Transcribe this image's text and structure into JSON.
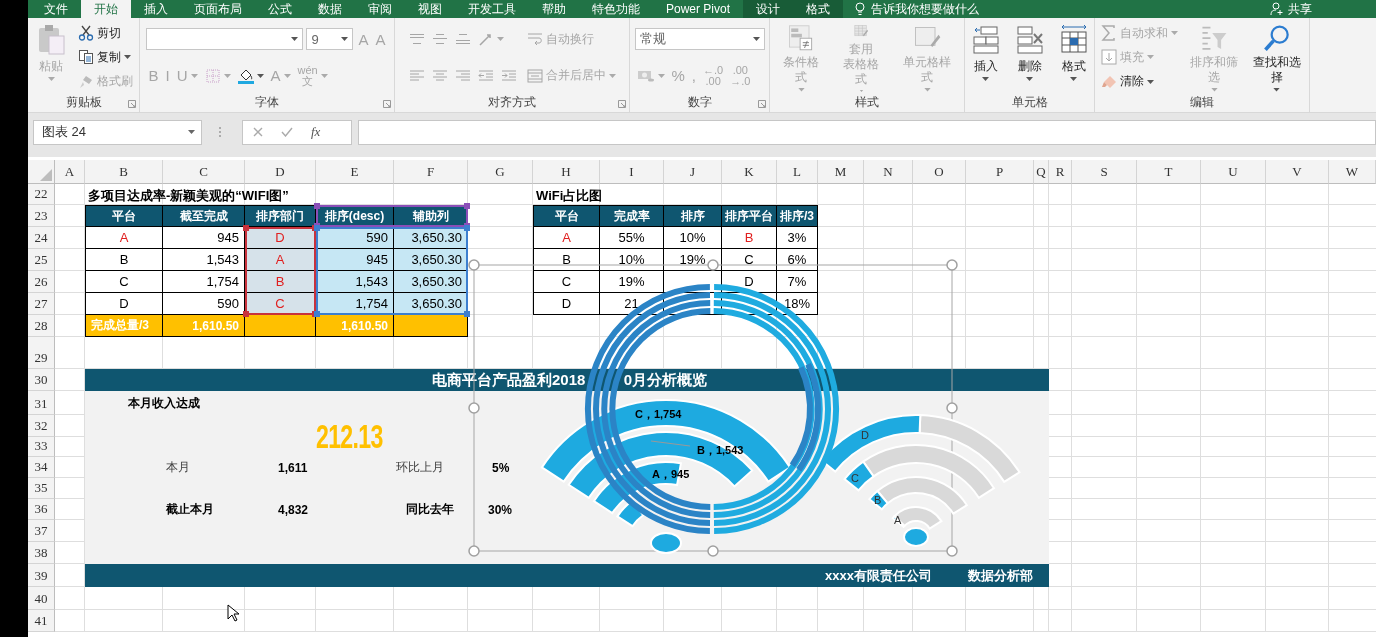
{
  "tabs": [
    {
      "label": "文件",
      "selected": false
    },
    {
      "label": "开始",
      "selected": true
    },
    {
      "label": "插入",
      "selected": false
    },
    {
      "label": "页面布局",
      "selected": false
    },
    {
      "label": "公式",
      "selected": false
    },
    {
      "label": "数据",
      "selected": false
    },
    {
      "label": "审阅",
      "selected": false
    },
    {
      "label": "视图",
      "selected": false
    },
    {
      "label": "开发工具",
      "selected": false
    },
    {
      "label": "帮助",
      "selected": false
    },
    {
      "label": "特色功能",
      "selected": false
    },
    {
      "label": "Power Pivot",
      "selected": false
    },
    {
      "label": "设计",
      "selected": false,
      "kind": "context"
    },
    {
      "label": "格式",
      "selected": false,
      "kind": "context"
    }
  ],
  "tell_me": {
    "placeholder": "告诉我你想要做什么"
  },
  "share": "共享",
  "ribbon": [
    {
      "label": "剪贴板",
      "launcher": true,
      "columns": [
        [
          {
            "kind": "large",
            "label": "粘贴",
            "disabled": true,
            "dropdown": true
          }
        ],
        [
          {
            "kind": "small",
            "label": "剪切",
            "disabled": false
          },
          {
            "kind": "small",
            "label": "复制",
            "disabled": false,
            "dropdown": true
          },
          {
            "kind": "small",
            "label": "格式刷",
            "disabled": true
          }
        ]
      ]
    },
    {
      "label": "字体",
      "launcher": true,
      "columns": [
        [
          {
            "kind": "row",
            "items": [
              {
                "kind": "field",
                "dropdown": true
              },
              {
                "kind": "field",
                "value": "9",
                "dropdown": true
              },
              {
                "kind": "glyph",
                "label": "A",
                "disabled": true
              },
              {
                "kind": "glyph",
                "label": "A",
                "disabled": true
              }
            ]
          },
          {
            "kind": "row",
            "items": [
              {
                "kind": "glyph",
                "label": "B",
                "disabled": true
              },
              {
                "kind": "glyph",
                "label": "I",
                "disabled": true
              },
              {
                "kind": "glyph",
                "label": "U",
                "disabled": true,
                "dropdown": true
              },
              {
                "kind": "icon",
                "disabled": true,
                "dropdown": true
              },
              {
                "kind": "icon",
                "disabled": false,
                "dropdown": true
              },
              {
                "kind": "glyph",
                "label": "A",
                "disabled": true,
                "dropdown": true
              },
              {
                "kind": "glyph",
                "label": "wén",
                "sub": "文",
                "disabled": true,
                "dropdown": true
              }
            ]
          }
        ]
      ]
    },
    {
      "label": "对齐方式",
      "launcher": true,
      "columns": [
        [
          {
            "kind": "row",
            "items": [
              {
                "kind": "icon",
                "disabled": true
              },
              {
                "kind": "icon",
                "disabled": true
              },
              {
                "kind": "icon",
                "disabled": true
              },
              {
                "kind": "icon",
                "disabled": true,
                "dropdown": true
              }
            ]
          },
          {
            "kind": "row",
            "items": [
              {
                "kind": "icon",
                "disabled": true
              },
              {
                "kind": "icon",
                "disabled": true
              },
              {
                "kind": "icon",
                "disabled": true
              },
              {
                "kind": "icon",
                "disabled": true
              },
              {
                "kind": "icon",
                "disabled": true
              }
            ]
          }
        ],
        [
          {
            "kind": "small",
            "label": "自动换行",
            "disabled": true
          },
          {
            "kind": "small",
            "label": "合并后居中",
            "disabled": true,
            "dropdown": true
          }
        ]
      ]
    },
    {
      "label": "数字",
      "launcher": true,
      "columns": [
        [
          {
            "kind": "row",
            "items": [
              {
                "kind": "field",
                "value": "常规",
                "dropdown": true
              }
            ]
          },
          {
            "kind": "row",
            "items": [
              {
                "kind": "icon",
                "disabled": true,
                "dropdown": true
              },
              {
                "kind": "glyph",
                "label": "%",
                "disabled": true
              },
              {
                "kind": "glyph",
                "label": ",",
                "disabled": true
              },
              {
                "kind": "glyph",
                "label": "←.0",
                "sub": ".00",
                "disabled": true
              },
              {
                "kind": "glyph",
                "label": ".00",
                "sub": "→.0",
                "disabled": true
              }
            ]
          }
        ]
      ]
    },
    {
      "label": "样式",
      "columns": [
        [
          {
            "kind": "large",
            "label": "条件格式",
            "disabled": true,
            "dropdown": true
          }
        ],
        [
          {
            "kind": "large",
            "label": "套用",
            "label_line2": "表格格式",
            "disabled": true,
            "dropdown": true
          }
        ],
        [
          {
            "kind": "large",
            "label": "单元格样式",
            "disabled": true,
            "dropdown": true
          }
        ]
      ]
    },
    {
      "label": "单元格",
      "columns": [
        [
          {
            "kind": "large",
            "label": "插入",
            "disabled": false,
            "dropdown": true
          }
        ],
        [
          {
            "kind": "large",
            "label": "删除",
            "disabled": false,
            "dropdown": true
          }
        ],
        [
          {
            "kind": "large",
            "label": "格式",
            "disabled": false,
            "dropdown": true
          }
        ]
      ]
    },
    {
      "label": "编辑",
      "columns": [
        [
          {
            "kind": "small",
            "label": "自动求和",
            "disabled": true,
            "dropdown": true
          },
          {
            "kind": "small",
            "label": "填充",
            "disabled": true,
            "dropdown": true
          },
          {
            "kind": "small",
            "label": "清除",
            "disabled": false,
            "dropdown": true
          }
        ],
        [
          {
            "kind": "large",
            "label": "排序和筛选",
            "disabled": true,
            "dropdown": true
          }
        ],
        [
          {
            "kind": "large",
            "label": "查找和选择",
            "disabled": false,
            "dropdown": true
          }
        ]
      ]
    }
  ],
  "name_box": "图表 24",
  "function_label": "fx",
  "columns": [
    "A",
    "B",
    "C",
    "D",
    "E",
    "F",
    "G",
    "H",
    "I",
    "J",
    "K",
    "L",
    "M",
    "N",
    "O",
    "P",
    "Q",
    "R",
    "S",
    "T",
    "U",
    "V",
    "W"
  ],
  "rows": [
    "22",
    "23",
    "24",
    "25",
    "26",
    "27",
    "28",
    "29",
    "30",
    "31",
    "32",
    "33",
    "34",
    "35",
    "36",
    "37",
    "38",
    "39",
    "40",
    "41"
  ],
  "table1": {
    "title": "多项目达成率-新颖美观的“WIFI图”",
    "columns": [
      {
        "label": "平台"
      },
      {
        "label": "截至完成"
      },
      {
        "label": "排序部门",
        "label_range": true
      },
      {
        "label": "排序(desc)",
        "value_range": true
      },
      {
        "label": "辅助列",
        "value_range": true
      }
    ],
    "rows": [
      [
        {
          "text": "A",
          "alert": true
        },
        "945",
        {
          "text": "D",
          "alert": true
        },
        "590",
        "3,650.30"
      ],
      [
        "B",
        "1,543",
        {
          "text": "A",
          "alert": true
        },
        "945",
        "3,650.30"
      ],
      [
        "C",
        "1,754",
        {
          "text": "B",
          "alert": true
        },
        "1,543",
        "3,650.30"
      ],
      [
        "D",
        "590",
        {
          "text": "C",
          "alert": true
        },
        "1,754",
        "3,650.30"
      ]
    ],
    "total": [
      "完成总量/3",
      "1,610.50",
      "1,610.50"
    ]
  },
  "table2": {
    "title": "WiFi占比图",
    "columns": [
      "平台",
      "完成率",
      "排序",
      "排序平台",
      "排序/3"
    ],
    "rows": [
      [
        {
          "text": "A",
          "alert": true
        },
        "55%",
        "10%",
        {
          "text": "B",
          "alert": true
        },
        "3%"
      ],
      [
        "B",
        "10%",
        "19%",
        "C",
        "6%"
      ],
      [
        "C",
        "19%",
        null,
        "D",
        "7%"
      ],
      [
        "D",
        "21",
        null,
        null,
        "18%"
      ]
    ]
  },
  "dashboard": {
    "title_left": "电商平台产品盈利2018",
    "title_right": "0月分析概览",
    "heading": "本月收入达成",
    "highlight": "212.13",
    "metrics": [
      {
        "label": "本月",
        "value": "1,611",
        "strong": false
      },
      {
        "label": "环比上月",
        "value": "5%",
        "strong": false
      },
      {
        "label": "截止本月",
        "value": "4,832",
        "strong": true
      },
      {
        "label": "同比去年",
        "value": "30%",
        "strong": true
      }
    ],
    "footer": [
      "xxxx有限责任公司",
      "数据分析部"
    ]
  },
  "chart": {
    "fan_labels": [
      "C，1,754",
      "B，1,543",
      "A，945"
    ],
    "wifi_labels": [
      "D",
      "C",
      "B",
      "A"
    ]
  }
}
